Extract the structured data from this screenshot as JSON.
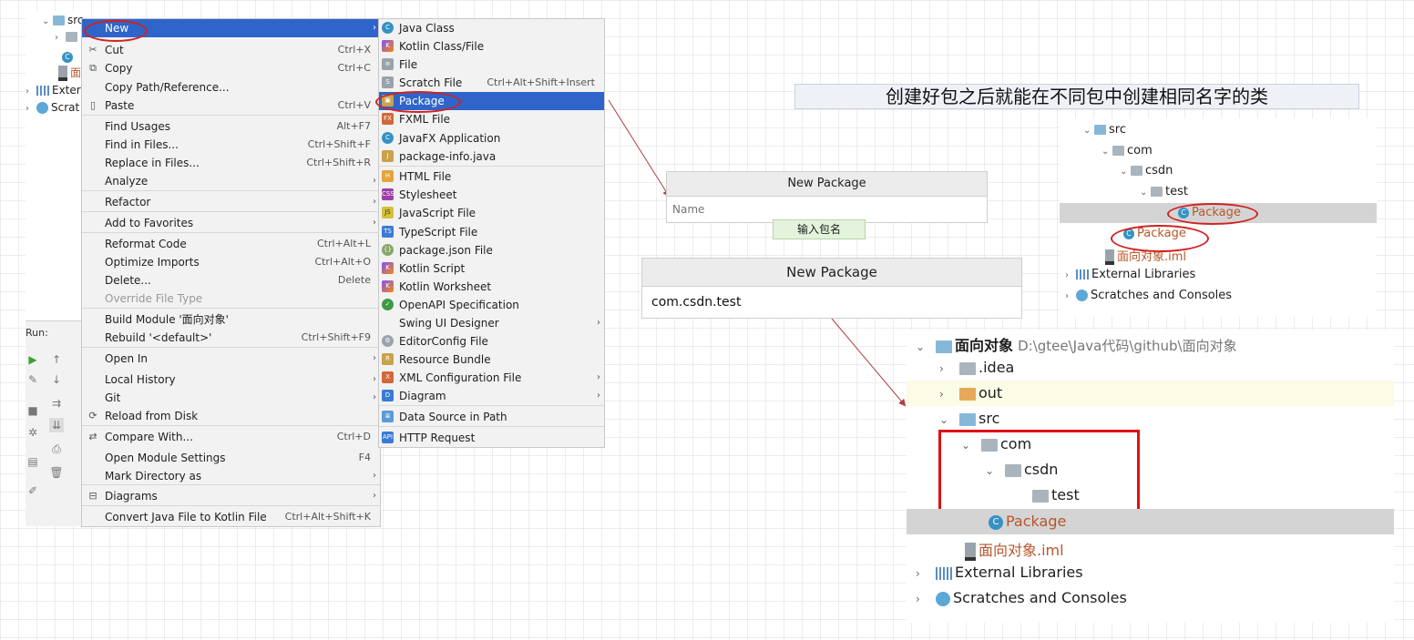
{
  "left_tree": {
    "src": "src",
    "iml_partial": "面",
    "ext_partial": "Exter",
    "scratch_partial": "Scrat"
  },
  "run_panel": {
    "label": "Run:"
  },
  "context_menu": {
    "items": [
      {
        "label": "New",
        "shortcut": "",
        "arrow": "›",
        "icon": ""
      },
      {
        "label": "Cut",
        "shortcut": "Ctrl+X",
        "arrow": "",
        "icon": "✂"
      },
      {
        "label": "Copy",
        "shortcut": "Ctrl+C",
        "arrow": "",
        "icon": "⧉"
      },
      {
        "label": "Copy Path/Reference...",
        "shortcut": "",
        "arrow": "",
        "icon": ""
      },
      {
        "label": "Paste",
        "shortcut": "Ctrl+V",
        "arrow": "",
        "icon": "▯"
      },
      {
        "label": "Find Usages",
        "shortcut": "Alt+F7",
        "arrow": "",
        "icon": ""
      },
      {
        "label": "Find in Files...",
        "shortcut": "Ctrl+Shift+F",
        "arrow": "",
        "icon": ""
      },
      {
        "label": "Replace in Files...",
        "shortcut": "Ctrl+Shift+R",
        "arrow": "",
        "icon": ""
      },
      {
        "label": "Analyze",
        "shortcut": "",
        "arrow": "›",
        "icon": ""
      },
      {
        "label": "Refactor",
        "shortcut": "",
        "arrow": "›",
        "icon": ""
      },
      {
        "label": "Add to Favorites",
        "shortcut": "",
        "arrow": "›",
        "icon": ""
      },
      {
        "label": "Reformat Code",
        "shortcut": "Ctrl+Alt+L",
        "arrow": "",
        "icon": ""
      },
      {
        "label": "Optimize Imports",
        "shortcut": "Ctrl+Alt+O",
        "arrow": "",
        "icon": ""
      },
      {
        "label": "Delete...",
        "shortcut": "Delete",
        "arrow": "",
        "icon": ""
      },
      {
        "label": "Override File Type",
        "shortcut": "",
        "arrow": "",
        "icon": ""
      },
      {
        "label": "Build Module '面向对象'",
        "shortcut": "",
        "arrow": "",
        "icon": ""
      },
      {
        "label": "Rebuild '<default>'",
        "shortcut": "Ctrl+Shift+F9",
        "arrow": "",
        "icon": ""
      },
      {
        "label": "Open In",
        "shortcut": "",
        "arrow": "›",
        "icon": ""
      },
      {
        "label": "Local History",
        "shortcut": "",
        "arrow": "›",
        "icon": ""
      },
      {
        "label": "Git",
        "shortcut": "",
        "arrow": "›",
        "icon": ""
      },
      {
        "label": "Reload from Disk",
        "shortcut": "",
        "arrow": "",
        "icon": "⟳"
      },
      {
        "label": "Compare With...",
        "shortcut": "Ctrl+D",
        "arrow": "",
        "icon": "⇄"
      },
      {
        "label": "Open Module Settings",
        "shortcut": "F4",
        "arrow": "",
        "icon": ""
      },
      {
        "label": "Mark Directory as",
        "shortcut": "",
        "arrow": "›",
        "icon": ""
      },
      {
        "label": "Diagrams",
        "shortcut": "",
        "arrow": "›",
        "icon": "⊟"
      },
      {
        "label": "Convert Java File to Kotlin File",
        "shortcut": "Ctrl+Alt+Shift+K",
        "arrow": "",
        "icon": ""
      }
    ]
  },
  "new_submenu": {
    "items": [
      {
        "label": "Java Class",
        "shortcut": "",
        "arrow": "",
        "icon": "C"
      },
      {
        "label": "Kotlin Class/File",
        "shortcut": "",
        "arrow": "",
        "icon": "K"
      },
      {
        "label": "File",
        "shortcut": "",
        "arrow": "",
        "icon": "≡"
      },
      {
        "label": "Scratch File",
        "shortcut": "Ctrl+Alt+Shift+Insert",
        "arrow": "",
        "icon": "S"
      },
      {
        "label": "Package",
        "shortcut": "",
        "arrow": "",
        "icon": "▣"
      },
      {
        "label": "FXML File",
        "shortcut": "",
        "arrow": "",
        "icon": "FX"
      },
      {
        "label": "JavaFX Application",
        "shortcut": "",
        "arrow": "",
        "icon": "C"
      },
      {
        "label": "package-info.java",
        "shortcut": "",
        "arrow": "",
        "icon": "J"
      },
      {
        "label": "HTML File",
        "shortcut": "",
        "arrow": "",
        "icon": "H"
      },
      {
        "label": "Stylesheet",
        "shortcut": "",
        "arrow": "",
        "icon": "CSS"
      },
      {
        "label": "JavaScript File",
        "shortcut": "",
        "arrow": "",
        "icon": "JS"
      },
      {
        "label": "TypeScript File",
        "shortcut": "",
        "arrow": "",
        "icon": "TS"
      },
      {
        "label": "package.json File",
        "shortcut": "",
        "arrow": "",
        "icon": "{}"
      },
      {
        "label": "Kotlin Script",
        "shortcut": "",
        "arrow": "",
        "icon": "K"
      },
      {
        "label": "Kotlin Worksheet",
        "shortcut": "",
        "arrow": "",
        "icon": "K"
      },
      {
        "label": "OpenAPI Specification",
        "shortcut": "",
        "arrow": "",
        "icon": "✓"
      },
      {
        "label": "Swing UI Designer",
        "shortcut": "",
        "arrow": "›",
        "icon": ""
      },
      {
        "label": "EditorConfig File",
        "shortcut": "",
        "arrow": "",
        "icon": "⚙"
      },
      {
        "label": "Resource Bundle",
        "shortcut": "",
        "arrow": "",
        "icon": "R"
      },
      {
        "label": "XML Configuration File",
        "shortcut": "",
        "arrow": "›",
        "icon": "X"
      },
      {
        "label": "Diagram",
        "shortcut": "",
        "arrow": "›",
        "icon": "D"
      },
      {
        "label": "Data Source in Path",
        "shortcut": "",
        "arrow": "",
        "icon": "≣"
      },
      {
        "label": "HTTP Request",
        "shortcut": "",
        "arrow": "",
        "icon": "API"
      }
    ]
  },
  "annotation": {
    "title": "创建好包之后就能在不同包中创建相同名字的类"
  },
  "dialog_small": {
    "title": "New Package",
    "placeholder": "Name",
    "hint": "输入包名"
  },
  "dialog_large": {
    "title": "New Package",
    "value": "com.csdn.test"
  },
  "tree_small": {
    "src": "src",
    "com": "com",
    "csdn": "csdn",
    "test": "test",
    "package_inner": "Package",
    "package_outer": "Package",
    "iml": "面向对象.iml",
    "ext": "External Libraries",
    "scratch": "Scratches and Consoles"
  },
  "tree_large": {
    "project": "面向对象",
    "path": "D:\\gtee\\Java代码\\github\\面向对象",
    "idea": ".idea",
    "out": "out",
    "src": "src",
    "com": "com",
    "csdn": "csdn",
    "test": "test",
    "package": "Package",
    "iml": "面向对象.iml",
    "ext": "External Libraries",
    "scratch": "Scratches and Consoles"
  }
}
